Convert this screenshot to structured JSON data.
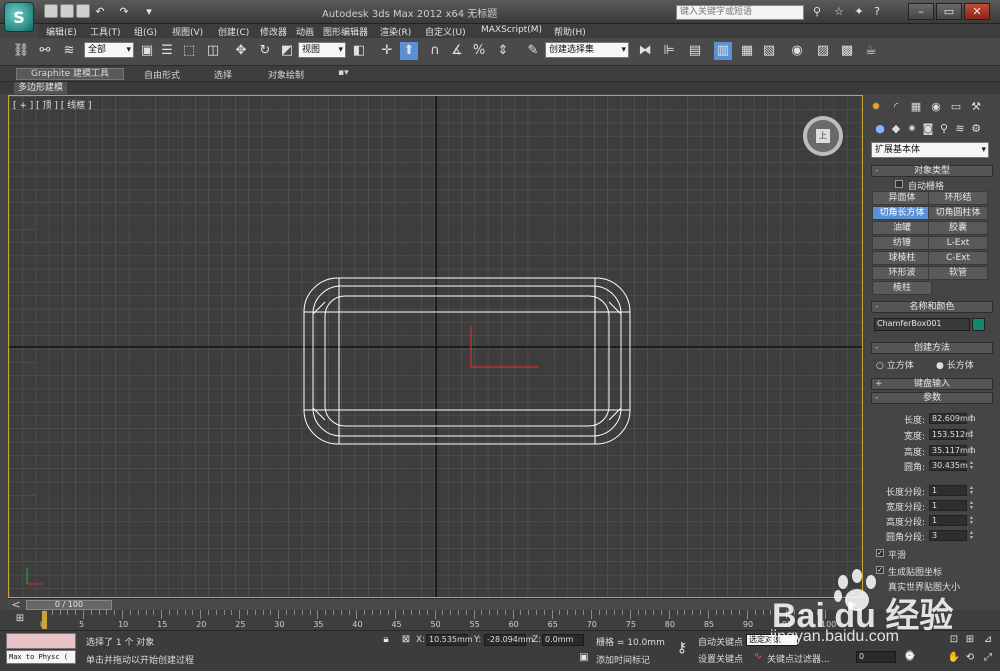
{
  "titlebar": {
    "title": "Autodesk 3ds Max  2012 x64       无标题",
    "search_placeholder": "键入关键字或短语",
    "logo_glyph": "S"
  },
  "menus": [
    "编辑(E)",
    "工具(T)",
    "组(G)",
    "视图(V)",
    "创建(C)",
    "修改器",
    "动画",
    "图形编辑器",
    "渲染(R)",
    "自定义(U)",
    "MAXScript(M)",
    "帮助(H)"
  ],
  "toolbar": {
    "filter_select": "全部",
    "refcoord_select": "视图",
    "named_selection": "创建选择集"
  },
  "ribbon": {
    "tabs": [
      "Graphite 建模工具",
      "自由形式",
      "选择",
      "对象绘制"
    ],
    "sub_label": "多边形建模"
  },
  "viewport": {
    "label": "[ + ] [ 顶 ] [ 线框 ]",
    "viewcube_face": "上"
  },
  "panel": {
    "category_select": "扩展基本体",
    "object_type_title": "对象类型",
    "autogrid": "自动栅格",
    "object_buttons": [
      "异面体",
      "环形结",
      "切角长方体",
      "切角圆柱体",
      "油罐",
      "胶囊",
      "纺锤",
      "L-Ext",
      "球棱柱",
      "C-Ext",
      "环形波",
      "软管",
      "棱柱"
    ],
    "active_button": "切角长方体",
    "name_color_title": "名称和颜色",
    "object_name": "ChamferBox001",
    "object_color": "#0f8a6a",
    "creation_title": "创建方法",
    "creation_options": [
      "立方体",
      "长方体"
    ],
    "creation_selected": "长方体",
    "keyboard_title": "键盘输入",
    "params_title": "参数",
    "params": [
      {
        "label": "长度:",
        "value": "82.609mm"
      },
      {
        "label": "宽度:",
        "value": "153.512m"
      },
      {
        "label": "高度:",
        "value": "35.117mm"
      },
      {
        "label": "圆角:",
        "value": "30.435m"
      }
    ],
    "segments": [
      {
        "label": "长度分段:",
        "value": "1"
      },
      {
        "label": "宽度分段:",
        "value": "1"
      },
      {
        "label": "高度分段:",
        "value": "1"
      },
      {
        "label": "圆角分段:",
        "value": "3"
      }
    ],
    "smooth": "平滑",
    "gen_map": "生成贴图坐标",
    "real_world": "真实世界贴图大小"
  },
  "timeline": {
    "slider_label": "0 / 100",
    "ticks": [
      "0",
      "5",
      "10",
      "15",
      "20",
      "25",
      "30",
      "35",
      "40",
      "45",
      "50",
      "55",
      "60",
      "65",
      "70",
      "75",
      "80",
      "85",
      "90",
      "95",
      "100"
    ]
  },
  "status": {
    "maxscript_text": "Max to Physc (",
    "selected_text": "选择了 1 个 对象",
    "prompt_text": "单击并拖动以开始创建过程",
    "x_label": "X:",
    "x_value": "10.535mm",
    "y_label": "Y:",
    "y_value": "-28.094mm",
    "z_label": "Z:",
    "z_value": "0.0mm",
    "grid_text": "栅格 = 10.0mm",
    "add_time_tag": "添加时间标记",
    "auto_key": "自动关键点",
    "selected_object": "选定对象",
    "set_key": "设置关键点",
    "key_filters": "关键点过滤器...",
    "frame_value": "0"
  },
  "watermark": {
    "brand": "Bai du 经验",
    "url": "jingyan.baidu.com"
  }
}
